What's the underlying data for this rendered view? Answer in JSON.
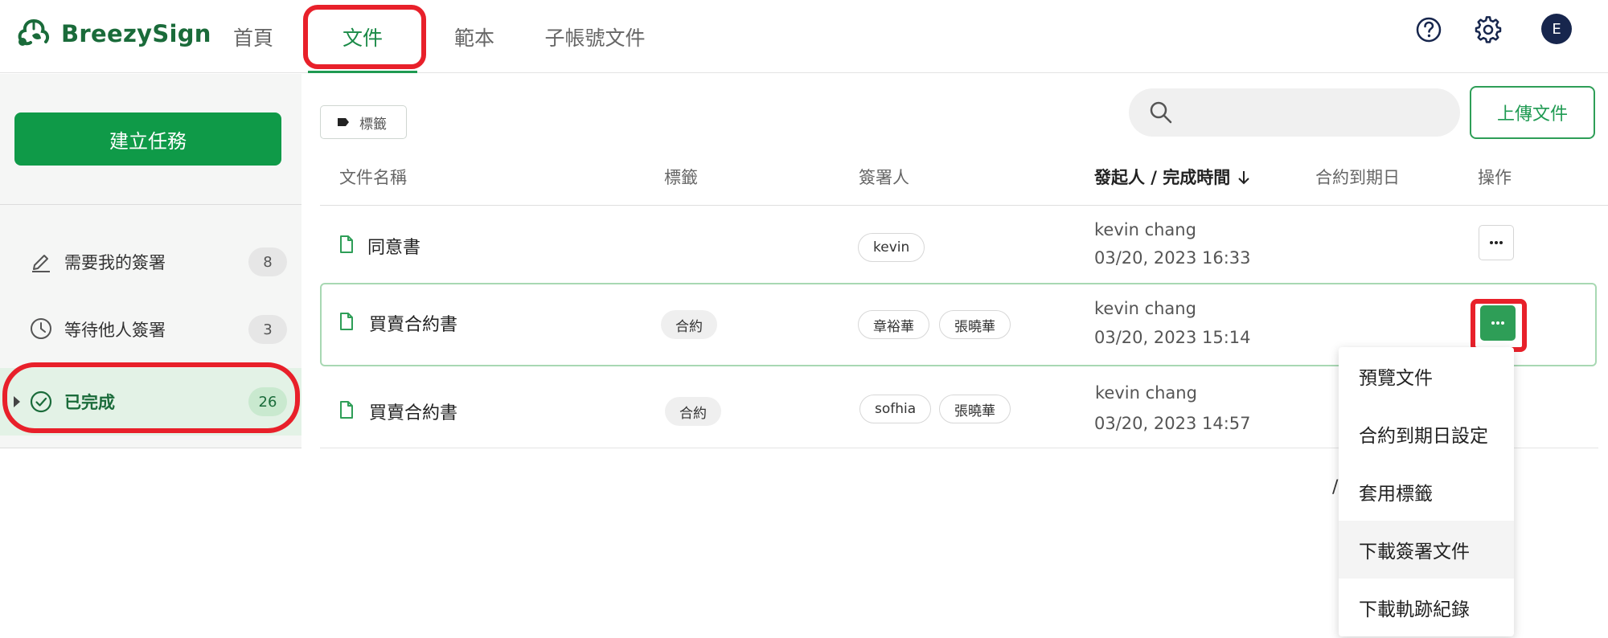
{
  "brand": {
    "name": "BreezySign",
    "color": "#1a6b3a",
    "accent": "#0f9a48"
  },
  "nav": {
    "tabs": [
      {
        "label": "首頁"
      },
      {
        "label": "文件"
      },
      {
        "label": "範本"
      },
      {
        "label": "子帳號文件"
      }
    ],
    "active_tab": "文件",
    "avatar_initial": "E"
  },
  "sidebar": {
    "create_label": "建立任務",
    "items": [
      {
        "label": "需要我的簽署",
        "count": "8",
        "icon": "pen-icon"
      },
      {
        "label": "等待他人簽署",
        "count": "3",
        "icon": "clock-icon"
      },
      {
        "label": "已完成",
        "count": "26",
        "icon": "check-circle-icon"
      }
    ]
  },
  "toolbar": {
    "tag_filter_label": "標籤",
    "search_placeholder": "",
    "upload_label": "上傳文件"
  },
  "table": {
    "columns": [
      "文件名稱",
      "標籤",
      "簽署人",
      "發起人 / 完成時間",
      "合約到期日",
      "操作"
    ],
    "rows": [
      {
        "name": "同意書",
        "tags": [],
        "signers": [
          "kevin"
        ],
        "initiator": "kevin chang",
        "time": "03/20, 2023 16:33",
        "expiry": ""
      },
      {
        "name": "買賣合約書",
        "tags": [
          "合約"
        ],
        "signers": [
          "章裕華",
          "張曉華"
        ],
        "initiator": "kevin chang",
        "time": "03/20, 2023 15:14",
        "expiry": ""
      },
      {
        "name": "買賣合約書",
        "tags": [
          "合約"
        ],
        "signers": [
          "sofhia",
          "張曉華"
        ],
        "initiator": "kevin chang",
        "time": "03/20, 2023 14:57",
        "expiry": ""
      }
    ]
  },
  "menu": {
    "items": [
      "預覽文件",
      "合約到期日設定",
      "套用標籤",
      "下載簽署文件",
      "下載軌跡紀錄"
    ],
    "hovered": "下載簽署文件"
  },
  "pager_fragment": "/",
  "highlight_color": "#e8202a"
}
